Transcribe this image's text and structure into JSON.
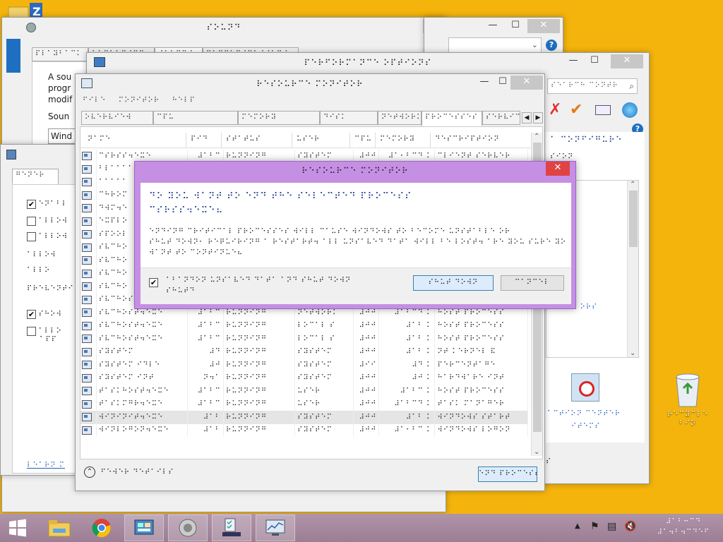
{
  "desktop": {
    "recycle_bin_label": "⠗⠑⠉⠽⠉⠇⠑\n⠃⠊⠝"
  },
  "win_sound": {
    "title": "⠎⠕⠥⠝⠙",
    "tabs": [
      "⠏⠇⠁⠽⠃⠁⠉⠅",
      "⠗⠑⠉⠕⠗⠙⠊⠝⠛",
      "⠎⠕⠥⠝⠙⠎",
      "⠉⠕⠍⠍⠥⠝⠊⠉⠁⠞⠊⠕⠝⠎"
    ],
    "text1": "A sou",
    "text2": "progr",
    "text3": "modif",
    "text4": "Soun",
    "select_value": "Wind"
  },
  "win_left": {
    "tab": "⠛⠑⠝⠑⠗",
    "options": [
      "⠑⠝⠁⠃⠇",
      "⠁⠇⠇⠕⠺",
      "⠁⠇⠇⠕⠺"
    ],
    "text_a": "⠁⠇⠇⠕⠺",
    "text_b": "⠁⠇⠇⠕",
    "text_c": "⠏⠗⠑⠧⠑⠝⠞⠊",
    "option4": "⠎⠓⠕⠺",
    "option5_l1": "⠁⠇⠇⠕",
    "option5_l2": "⠁⠏⠏",
    "link": "⠇⠑⠁⠗⠝ ⠍"
  },
  "win_settings": {
    "title": "⠏⠑⠗⠋⠕⠗⠍⠁⠝⠉⠑ ⠕⠏⠞⠊⠕⠝⠎",
    "search_placeholder": "⠎⠑⠁⠗⠉⠓ ⠉⠕⠝⠞⠗",
    "heading": "⠁ ⠉⠕⠝⠋⠊⠛⠥⠗⠑",
    "sub": "⠎⠊⠕⠝",
    "link": "⠊⠇⠇⠞ ⠕⠗⠎",
    "bottom_l1": "⠁⠉⠞⠊⠕⠝ ⠉⠑⠝⠞⠑⠗",
    "bottom_l2": "⠊⠞⠑⠍⠎",
    "bottom_right": "⠎"
  },
  "win_rm": {
    "title": "⠗⠑⠎⠕⠥⠗⠉⠑ ⠍⠕⠝⠊⠞⠕⠗",
    "menu": [
      "⠋⠊⠇⠑",
      "⠍⠕⠝⠊⠞⠕⠗",
      "⠓⠑⠇⠏"
    ],
    "tabs": [
      "⠕⠧⠑⠗⠧⠊⠑⠺",
      "⠉⠏⠥",
      "⠍⠑⠍⠕⠗⠽",
      "⠙⠊⠎⠅",
      "⠝⠑⠞⠺⠕⠗⠅",
      "⠏⠗⠕⠉⠑⠎⠎⠑⠎",
      "⠎⠑⠗⠧⠊⠉⠑⠎"
    ],
    "columns": [
      "⠝⠁⠍⠑",
      "⠏⠊⠙",
      "⠎⠞⠁⠞⠥⠎",
      "⠥⠎⠑⠗",
      "⠉⠏⠥",
      "⠍⠑⠍⠕⠗⠽",
      "⠙⠑⠎⠉⠗⠊⠏⠞⠊⠕⠝"
    ],
    "rows": [
      [
        "⠉⠎⠗⠎⠎⠲⠑⠭⠑",
        "⠼⠁⠃⠉",
        "⠗⠥⠝⠝⠊⠝⠛",
        "⠎⠽⠎⠞⠑⠍",
        "⠼⠚⠚",
        "⠼⠁⠂⠃⠉⠙ ⠅",
        "⠉⠇⠊⠑⠝⠞ ⠎⠑⠗⠧⠑⠗"
      ],
      [
        "⠃⠇⠁⠁⠁⠁",
        "",
        "",
        "",
        "",
        "",
        ""
      ],
      [
        "⠁⠁⠁⠁⠁",
        "",
        "",
        "",
        "",
        "",
        ""
      ],
      [
        "⠉⠓⠗⠕⠍",
        "",
        "",
        "",
        "",
        "",
        ""
      ],
      [
        "⠙⠺⠍⠲⠑",
        "",
        "",
        "",
        "",
        "",
        ""
      ],
      [
        "⠑⠭⠏⠇⠕",
        "",
        "",
        "",
        "",
        "",
        ""
      ],
      [
        "⠎⠏⠕⠕⠇",
        "",
        "",
        "",
        "",
        "",
        ""
      ],
      [
        "⠎⠧⠉⠓⠕",
        "",
        "",
        "",
        "",
        "",
        ""
      ],
      [
        "⠎⠧⠉⠓⠕",
        "",
        "",
        "",
        "",
        "",
        ""
      ],
      [
        "⠎⠧⠉⠓⠕",
        "",
        "",
        "",
        "",
        "",
        ""
      ],
      [
        "⠎⠧⠉⠓⠕",
        "",
        "",
        "",
        "",
        "",
        ""
      ],
      [
        "⠎⠧⠉⠓⠕⠎⠞⠲⠑⠭⠑",
        "⠼⠁⠃",
        "⠗⠥⠝⠝⠊⠝⠛",
        "⠇⠕⠉⠁⠇ ⠎",
        "⠼⠚⠚",
        "⠼⠁⠃⠉ ⠅",
        "⠓⠕⠎⠞ ⠏⠗⠕⠉⠑⠎⠎"
      ],
      [
        "⠎⠧⠉⠓⠕⠎⠞⠲⠑⠭⠑",
        "⠼⠁⠃⠉",
        "⠗⠥⠝⠝⠊⠝⠛",
        "⠝⠑⠞⠺⠕⠗⠅",
        "⠼⠚⠚",
        "⠼⠁⠃⠉⠙ ⠅",
        "⠓⠕⠎⠞ ⠏⠗⠕⠉⠑⠎⠎"
      ],
      [
        "⠎⠧⠉⠓⠕⠎⠞⠲⠑⠭⠑",
        "⠼⠁⠃⠉",
        "⠗⠥⠝⠝⠊⠝⠛",
        "⠇⠕⠉⠁⠇ ⠎",
        "⠼⠚⠚",
        "⠼⠁⠃ ⠅",
        "⠓⠕⠎⠞ ⠏⠗⠕⠉⠑⠎⠎"
      ],
      [
        "⠎⠧⠉⠓⠕⠎⠞⠲⠑⠭⠑",
        "⠼⠁⠃⠉",
        "⠗⠥⠝⠝⠊⠝⠛",
        "⠇⠕⠉⠁⠇ ⠎",
        "⠼⠚⠚",
        "⠼⠁⠃ ⠅",
        "⠓⠕⠎⠞ ⠏⠗⠕⠉⠑⠎⠎"
      ],
      [
        "⠎⠽⠎⠞⠑⠍",
        "⠼⠙",
        "⠗⠥⠝⠝⠊⠝⠛",
        "⠎⠽⠎⠞⠑⠍",
        "⠼⠚⠚",
        "⠼⠁⠃ ⠅",
        "⠝⠞ ⠅⠑⠗⠝⠑⠇ ⠯"
      ],
      [
        "⠎⠽⠎⠞⠑⠍ ⠊⠙⠇⠑",
        "⠼⠚",
        "⠗⠥⠝⠝⠊⠝⠛",
        "⠎⠽⠎⠞⠑⠍",
        "⠼⠊⠊",
        "⠼⠙ ⠅",
        "⠏⠑⠗⠉⠑⠝⠞⠁⠛⠑"
      ],
      [
        "⠎⠽⠎⠞⠑⠍ ⠊⠝⠞",
        "⠝⠲⠁",
        "⠗⠥⠝⠝⠊⠝⠛",
        "⠎⠽⠎⠞⠑⠍",
        "⠼⠚⠚",
        "⠼⠚ ⠅",
        "⠓⠁⠗⠙⠺⠁⠗⠑ ⠊⠝⠞"
      ],
      [
        "⠞⠁⠎⠅⠓⠕⠎⠞⠲⠑⠭⠑",
        "⠼⠁⠃⠉",
        "⠗⠥⠝⠝⠊⠝⠛",
        "⠥⠎⠑⠗",
        "⠼⠚⠚",
        "⠼⠁⠃⠉ ⠅",
        "⠓⠕⠎⠞ ⠏⠗⠕⠉⠑⠎⠎"
      ],
      [
        "⠞⠁⠎⠅⠍⠛⠗⠲⠑⠭⠑",
        "⠼⠁⠃⠉",
        "⠗⠥⠝⠝⠊⠝⠛",
        "⠥⠎⠑⠗",
        "⠼⠚⠚",
        "⠼⠁⠃⠉⠙ ⠅",
        "⠞⠁⠎⠅ ⠍⠁⠝⠁⠛⠑⠗"
      ],
      [
        "⠺⠊⠝⠊⠝⠊⠞⠲⠑⠭⠑",
        "⠼⠁⠃",
        "⠗⠥⠝⠝⠊⠝⠛",
        "⠎⠽⠎⠞⠑⠍",
        "⠼⠚⠚",
        "⠼⠁⠃ ⠅",
        "⠺⠊⠝⠙⠕⠺⠎ ⠎⠞⠁⠗⠞"
      ],
      [
        "⠺⠊⠝⠇⠕⠛⠕⠝⠲⠑⠭⠑",
        "⠼⠁⠃",
        "⠗⠥⠝⠝⠊⠝⠛",
        "⠎⠽⠎⠞⠑⠍",
        "⠼⠚⠚",
        "⠼⠁⠂⠃⠉ ⠅",
        "⠺⠊⠝⠙⠕⠺⠎ ⠇⠕⠛⠕⠝"
      ]
    ],
    "fewer_details": "⠋⠑⠺⠑⠗ ⠙⠑⠞⠁⠊⠇⠎",
    "end_process": "⠑⠝⠙ ⠏⠗⠕⠉⠑⠎⠎"
  },
  "dialog": {
    "title": "⠗⠑⠎⠕⠥⠗⠉⠑ ⠍⠕⠝⠊⠞⠕⠗",
    "heading": "⠙⠕ ⠽⠕⠥ ⠺⠁⠝⠞ ⠞⠕ ⠑⠝⠙ ⠞⠓⠑ ⠎⠑⠇⠑⠉⠞⠑⠙ ⠏⠗⠕⠉⠑⠎⠎\n⠉⠎⠗⠎⠎⠲⠑⠭⠑⠦",
    "body": "⠑⠝⠙⠊⠝⠛ ⠉⠗⠊⠞⠊⠉⠁⠇ ⠏⠗⠕⠉⠑⠎⠎⠑⠎ ⠺⠊⠇⠇ ⠉⠁⠥⠎⠑ ⠺⠊⠝⠙⠕⠺⠎ ⠞⠕ ⠃⠑⠉⠕⠍⠑ ⠥⠝⠎⠞⠁⠃⠇⠑ ⠕⠗\n⠎⠓⠥⠞ ⠙⠕⠺⠝⠂ ⠗⠑⠟⠥⠊⠗⠊⠝⠛ ⠁ ⠗⠑⠎⠞⠁⠗⠞⠲ ⠁⠇⠇ ⠥⠝⠎⠁⠧⠑⠙ ⠙⠁⠞⠁ ⠺⠊⠇⠇ ⠃⠑ ⠇⠕⠎⠞⠲ ⠁⠗⠑ ⠽⠕⠥ ⠎⠥⠗⠑ ⠽⠕⠥\n⠺⠁⠝⠞ ⠞⠕ ⠉⠕⠝⠞⠊⠝⠥⠑⠦",
    "checkbox_label": "⠁⠃⠁⠝⠙⠕⠝ ⠥⠝⠎⠁⠧⠑⠙ ⠙⠁⠞⠁ ⠁⠝⠙ ⠎⠓⠥⠞ ⠙⠕⠺⠝\n⠎⠓⠥⠞⠙",
    "checked": true,
    "confirm_button": "⠎⠓⠥⠞ ⠙⠕⠺⠝",
    "cancel_button": "⠉⠁⠝⠉⠑⠇"
  },
  "taskbar": {
    "clock_time": "⠼⠁⠃⠒⠉⠙",
    "clock_date": "⠼⠁⠲⠃⠲⠉⠙⠑⠋"
  },
  "colors": {
    "desktop": "#f4b40c",
    "dialog_frame": "#c58fe4",
    "dialog_title": "#c58fe4",
    "braille_blue": "#1f3e8a",
    "taskbar": "#a88aa0"
  }
}
